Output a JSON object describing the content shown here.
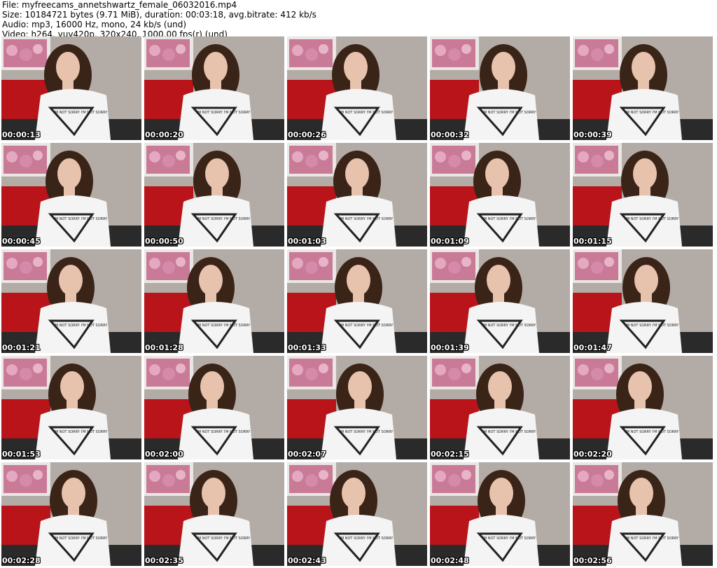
{
  "header": {
    "line1": "File: myfreecams_annetshwartz_female_06032016.mp4",
    "line2": "Size: 10184721 bytes (9.71 MiB), duration: 00:03:18, avg.bitrate: 412 kb/s",
    "line3": "Audio: mp3, 16000 Hz, mono, 24 kb/s (und)",
    "line4": "Video: h264, yuv420p, 320x240, 1000.00 fps(r) (und)"
  },
  "thumbnails": [
    {
      "timestamp": "00:00:13"
    },
    {
      "timestamp": "00:00:20"
    },
    {
      "timestamp": "00:00:26"
    },
    {
      "timestamp": "00:00:32"
    },
    {
      "timestamp": "00:00:39"
    },
    {
      "timestamp": "00:00:45"
    },
    {
      "timestamp": "00:00:50"
    },
    {
      "timestamp": "00:01:03"
    },
    {
      "timestamp": "00:01:09"
    },
    {
      "timestamp": "00:01:15"
    },
    {
      "timestamp": "00:01:21"
    },
    {
      "timestamp": "00:01:28"
    },
    {
      "timestamp": "00:01:33"
    },
    {
      "timestamp": "00:01:39"
    },
    {
      "timestamp": "00:01:47"
    },
    {
      "timestamp": "00:01:53"
    },
    {
      "timestamp": "00:02:00"
    },
    {
      "timestamp": "00:02:07"
    },
    {
      "timestamp": "00:02:15"
    },
    {
      "timestamp": "00:02:20"
    },
    {
      "timestamp": "00:02:28"
    },
    {
      "timestamp": "00:02:35"
    },
    {
      "timestamp": "00:02:43"
    },
    {
      "timestamp": "00:02:48"
    },
    {
      "timestamp": "00:02:56"
    }
  ],
  "colors": {
    "wall": "#b3aca6",
    "sofa": "#b8141a",
    "shirt": "#f4f4f4",
    "hair": "#3a2418",
    "skin": "#e7c2ad",
    "poster": "#c97a97",
    "timestamp": "#ffffff"
  }
}
